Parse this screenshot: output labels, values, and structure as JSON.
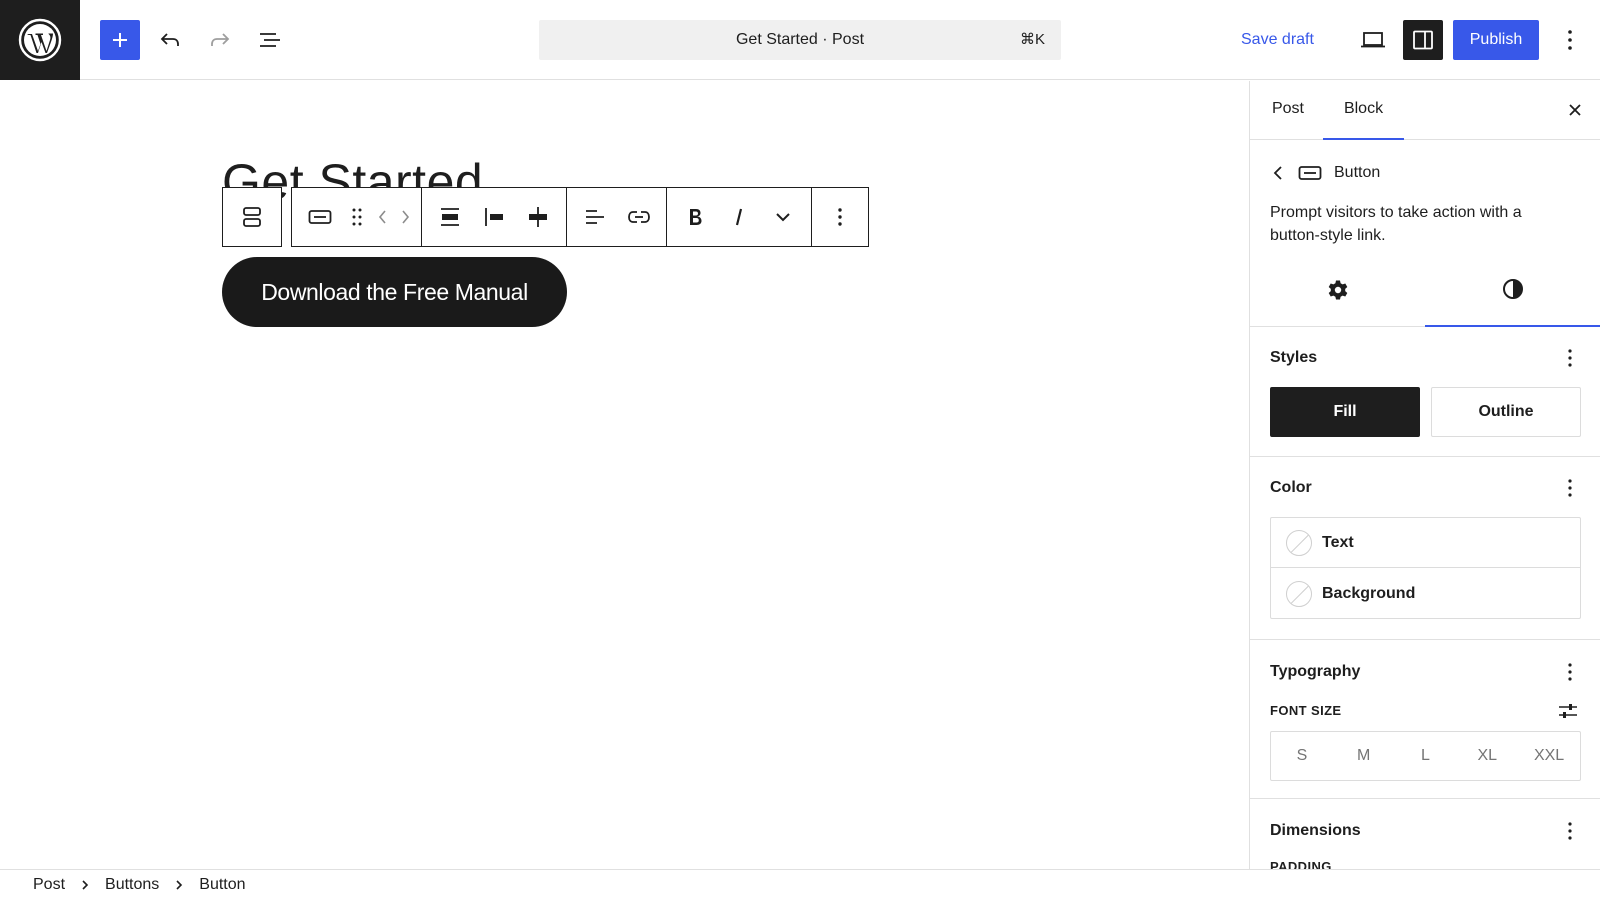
{
  "header": {
    "app_logo": "wordpress-logo",
    "command_bar": {
      "title": "Get Started · Post",
      "shortcut": "⌘K"
    },
    "save_draft_label": "Save draft",
    "publish_label": "Publish",
    "colors": {
      "accent": "#3858e9",
      "dark": "#1e1e1e"
    }
  },
  "canvas": {
    "post_title": "Get Started",
    "button_text": "Download the Free Manual",
    "toolbar_icons": [
      "buttons-parent-icon",
      "button-block-icon",
      "drag-handle-icon",
      "move-arrows-icon",
      "justify-center-icon",
      "justify-left-icon",
      "vertical-align-icon",
      "text-align-left-icon",
      "link-icon",
      "bold-icon",
      "italic-icon",
      "more-formatting-chevron-icon",
      "block-options-icon"
    ]
  },
  "sidebar": {
    "tabs": {
      "post": "Post",
      "block": "Block"
    },
    "block": {
      "name": "Button",
      "description": "Prompt visitors to take action with a button-style link."
    },
    "styles": {
      "title": "Styles",
      "fill": "Fill",
      "outline": "Outline"
    },
    "color": {
      "title": "Color",
      "text": "Text",
      "background": "Background"
    },
    "typography": {
      "title": "Typography",
      "font_size_label": "FONT SIZE",
      "sizes": [
        "S",
        "M",
        "L",
        "XL",
        "XXL"
      ]
    },
    "dimensions": {
      "title": "Dimensions",
      "padding_label": "PADDING"
    }
  },
  "footer": {
    "breadcrumbs": [
      "Post",
      "Buttons",
      "Button"
    ]
  }
}
